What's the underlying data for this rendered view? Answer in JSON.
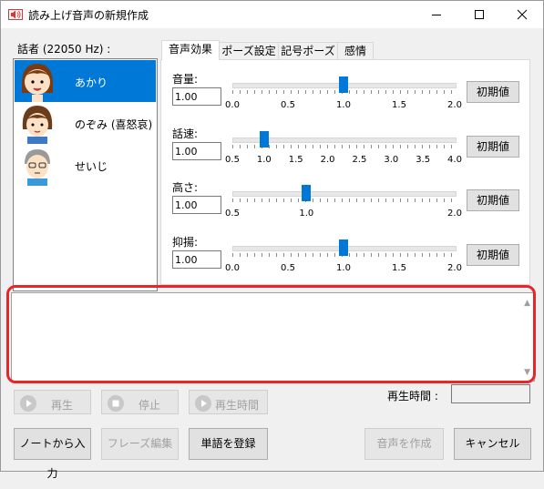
{
  "window": {
    "title": "読み上げ音声の新規作成",
    "buttons": {
      "minimize": "minimize",
      "maximize": "maximize",
      "close": "close"
    }
  },
  "speakers": {
    "label": "話者 (22050 Hz) :",
    "items": [
      {
        "name": "あかり",
        "selected": true,
        "icon": "akari-face-icon"
      },
      {
        "name": "のぞみ (喜怒哀)",
        "selected": false,
        "icon": "nozomi-face-icon"
      },
      {
        "name": "せいじ",
        "selected": false,
        "icon": "seiji-face-icon"
      }
    ]
  },
  "tabs": [
    "音声効果",
    "ポーズ設定",
    "記号ポーズ",
    "感情"
  ],
  "active_tab": 0,
  "params": [
    {
      "label": "音量:",
      "value": "1.00",
      "min": 0.0,
      "max": 2.0,
      "current": 1.0,
      "ticks": [
        "0.0",
        "0.5",
        "1.0",
        "1.5",
        "2.0"
      ],
      "reset": "初期値"
    },
    {
      "label": "話速:",
      "value": "1.00",
      "min": 0.5,
      "max": 4.0,
      "current": 1.0,
      "ticks": [
        "0.5",
        "1.0",
        "1.5",
        "2.0",
        "2.5",
        "3.0",
        "3.5",
        "4.0"
      ],
      "reset": "初期値"
    },
    {
      "label": "高さ:",
      "value": "1.00",
      "min": 0.5,
      "max": 2.0,
      "current": 1.0,
      "ticks": [
        "0.5",
        "1.0",
        "2.0"
      ],
      "reset": "初期値"
    },
    {
      "label": "抑揚:",
      "value": "1.00",
      "min": 0.0,
      "max": 2.0,
      "current": 1.0,
      "ticks": [
        "0.0",
        "0.5",
        "1.0",
        "1.5",
        "2.0"
      ],
      "reset": "初期値"
    }
  ],
  "text_area": {
    "value": ""
  },
  "playback": {
    "play": "再生",
    "stop": "停止",
    "play_time": "再生時間",
    "time_label": "再生時間 :",
    "time_value": ""
  },
  "actions": {
    "from_note": "ノートから入力",
    "phrase_edit": "フレーズ編集",
    "register_word": "単語を登録",
    "create_audio": "音声を作成",
    "cancel": "キャンセル"
  },
  "colors": {
    "selection": "#0078d7",
    "highlight": "#e8252a",
    "thumb": "#0078d7"
  }
}
